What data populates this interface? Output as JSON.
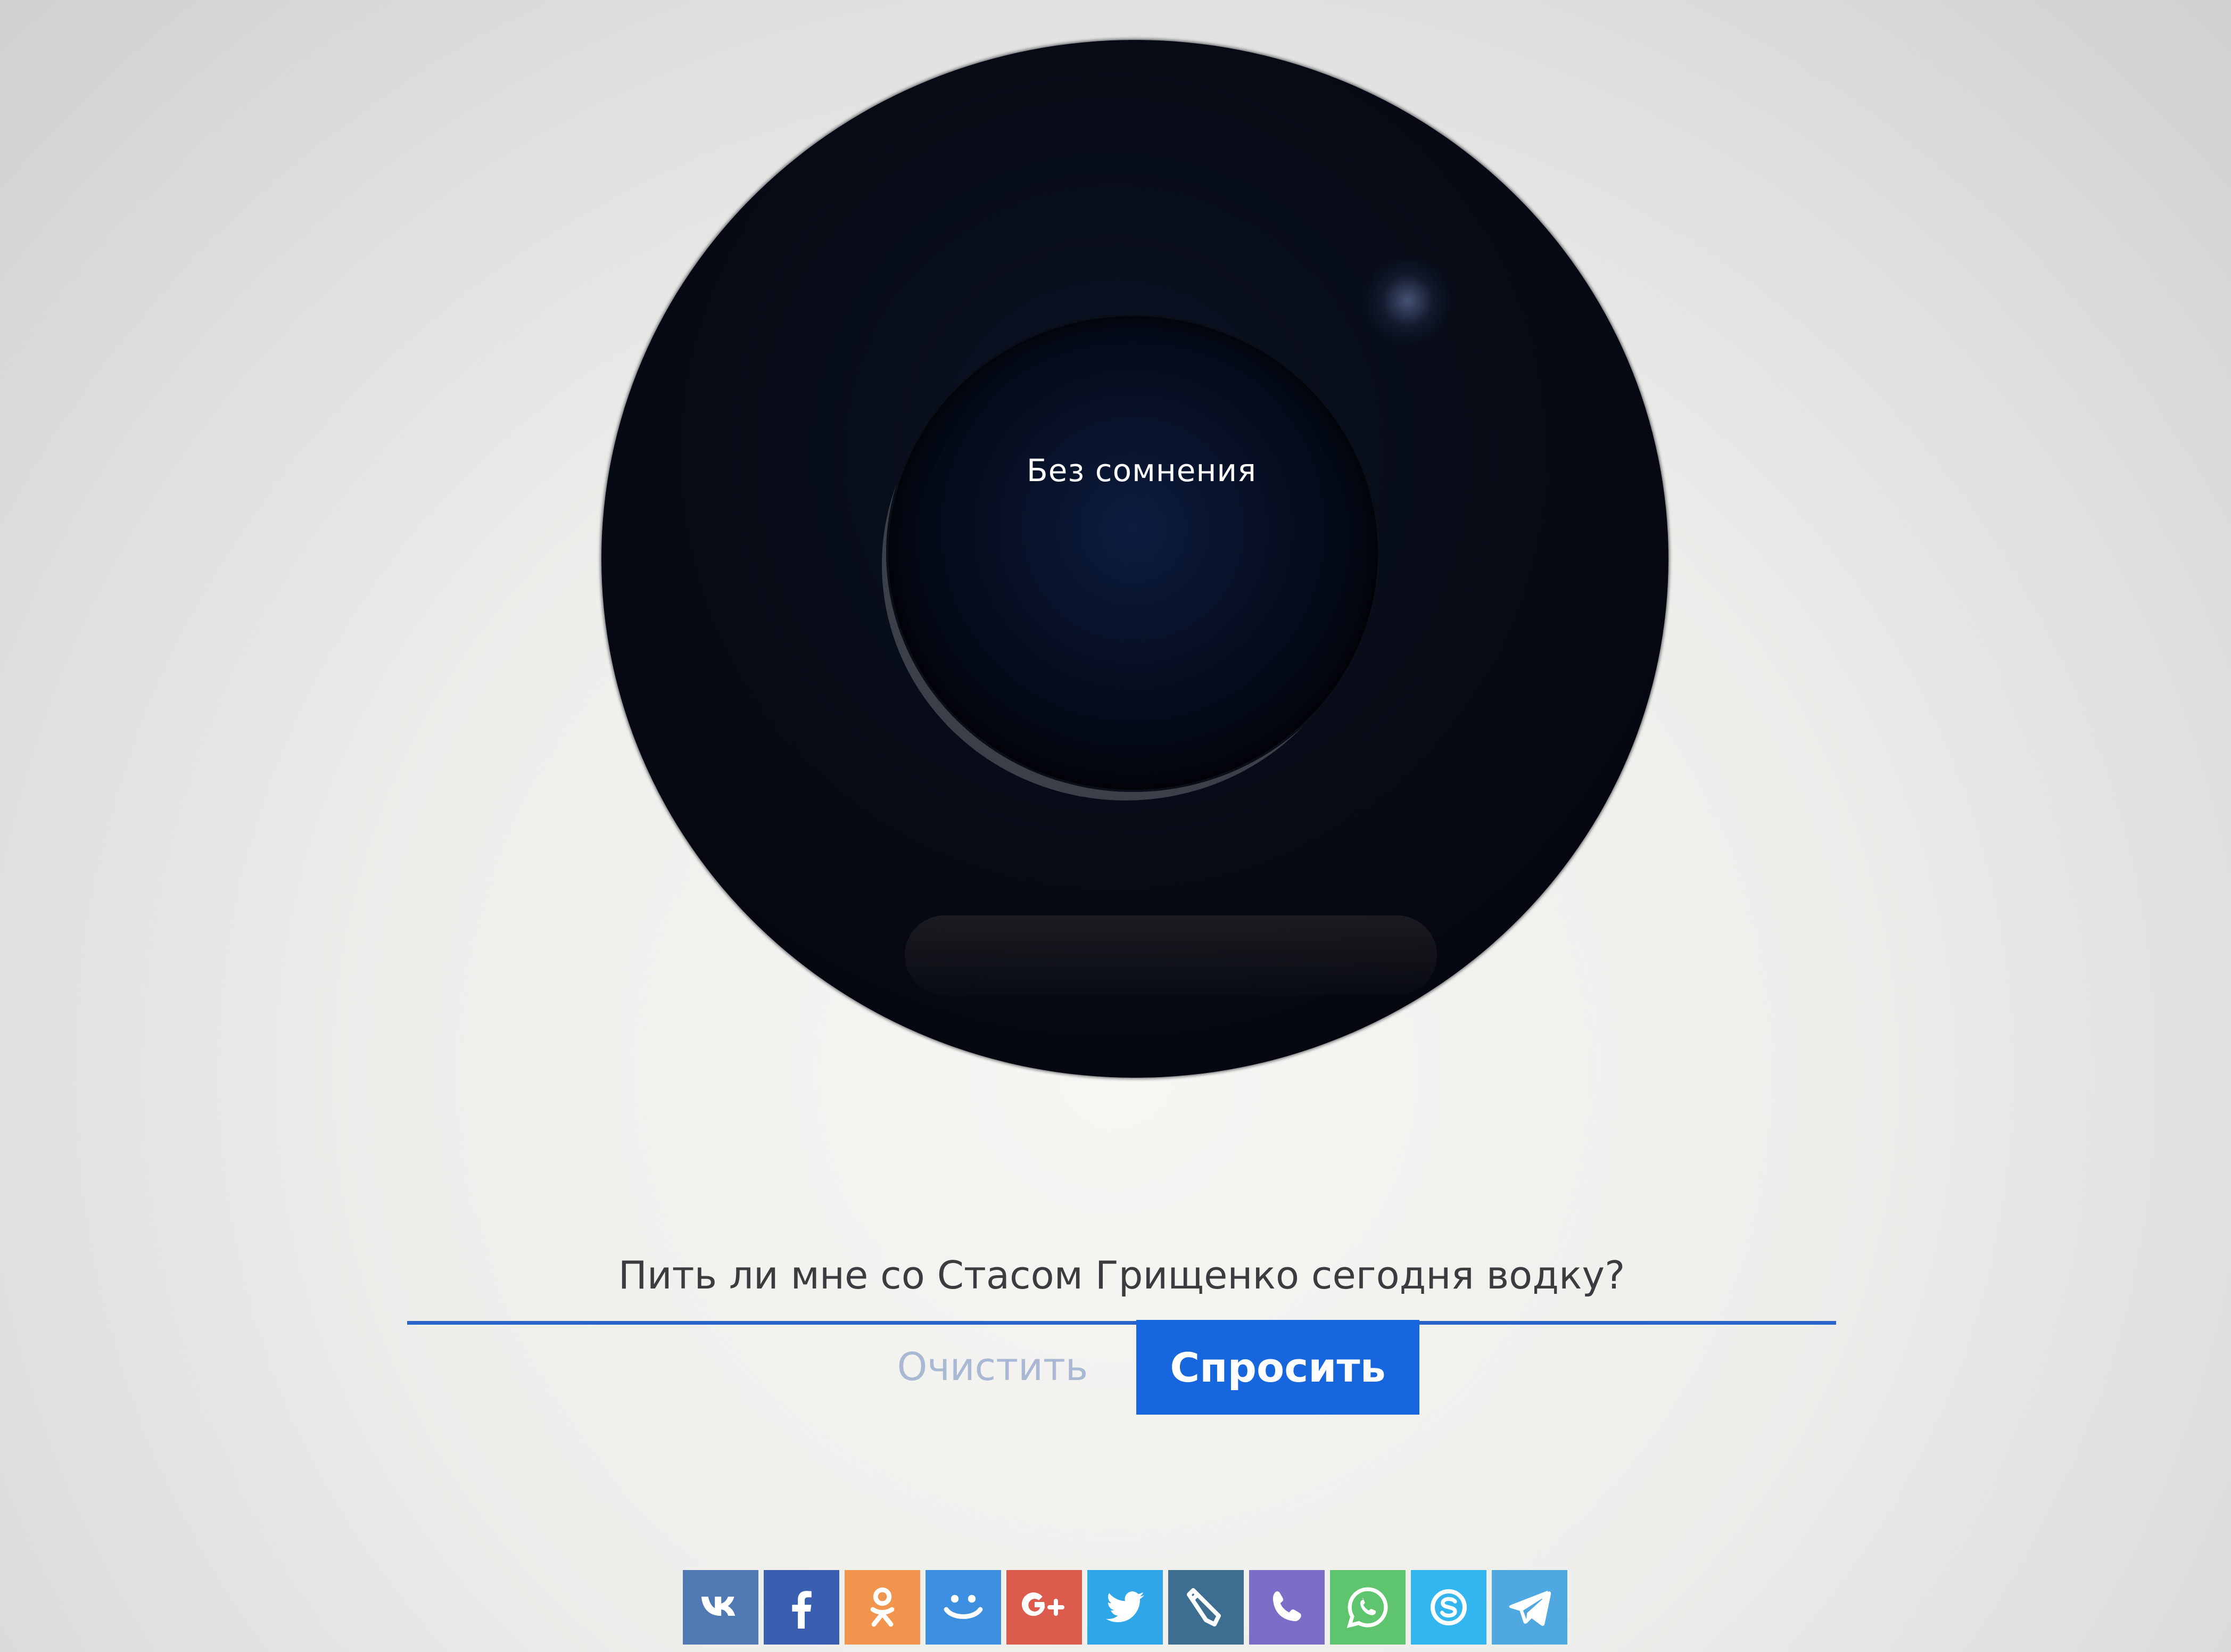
{
  "ball": {
    "answer": "Без сомнения"
  },
  "question": {
    "value": "Пить ли мне со Стасом Грищенко сегодня водку?"
  },
  "buttons": {
    "clear_label": "Очистить",
    "ask_label": "Спросить"
  },
  "share": [
    {
      "icon": "vk-icon",
      "color": "#5079b3"
    },
    {
      "icon": "facebook-icon",
      "color": "#3b5fb0"
    },
    {
      "icon": "odnoklassniki-icon",
      "color": "#f0944e"
    },
    {
      "icon": "moimir-icon",
      "color": "#3d8fe0"
    },
    {
      "icon": "googleplus-icon",
      "color": "#dd5b4d"
    },
    {
      "icon": "twitter-icon",
      "color": "#2fa6e8"
    },
    {
      "icon": "livejournal-icon",
      "color": "#3d6e92"
    },
    {
      "icon": "viber-icon",
      "color": "#7b6ec8"
    },
    {
      "icon": "whatsapp-icon",
      "color": "#5ec46e"
    },
    {
      "icon": "skype-icon",
      "color": "#33b6f0"
    },
    {
      "icon": "telegram-icon",
      "color": "#4fa8e0"
    }
  ]
}
